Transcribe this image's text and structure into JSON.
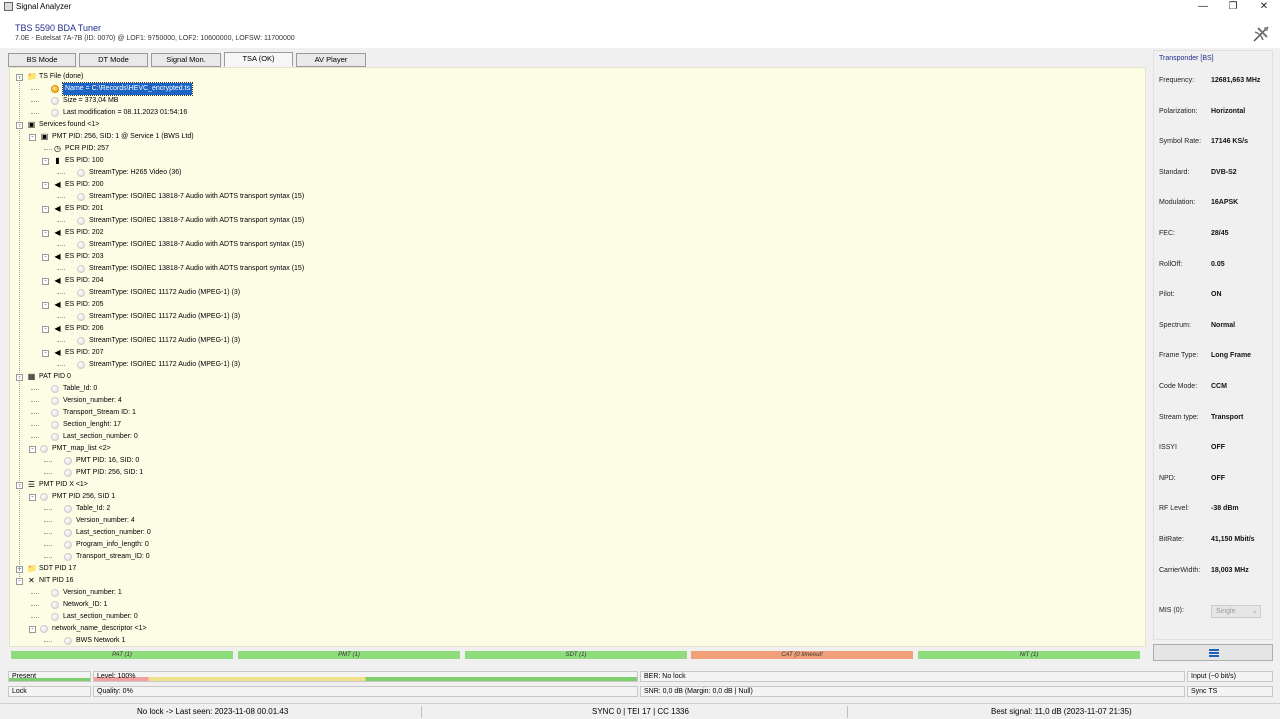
{
  "window": {
    "title": "Signal Analyzer",
    "controls": [
      "—",
      "❐",
      "✕"
    ]
  },
  "header": {
    "tuner_name": "TBS 5590 BDA Tuner",
    "tuner_info": "7.0E - Eutelsat 7A-7B (ID: 0070) @ LOF1: 9750000, LOF2: 10600000, LOFSW: 11700000"
  },
  "tabs": [
    {
      "label": "BS Mode"
    },
    {
      "label": "DT Mode"
    },
    {
      "label": "Signal Mon."
    },
    {
      "label": "TSA (OK)",
      "active": true
    },
    {
      "label": "AV Player"
    }
  ],
  "tree": [
    {
      "text": "TS File (done)",
      "depth": 0,
      "exp": "-",
      "icon": "folder-icon"
    },
    {
      "text": "Name = C:\\Records\\HEVC_encrypted.ts",
      "depth": 1,
      "icon": "dot-orange",
      "selected": true
    },
    {
      "text": "Size = 373,04 MB",
      "depth": 1,
      "icon": "dot"
    },
    {
      "text": "Last modification = 08.11.2023 01:54:16",
      "depth": 1,
      "icon": "dot"
    },
    {
      "text": "Services found <1>",
      "depth": 0,
      "exp": "-",
      "icon": "tv-icon"
    },
    {
      "text": "PMT PID: 256, SID: 1 @ Service 1 (BWS Ltd)",
      "depth": 1,
      "exp": "-",
      "icon": "tv-icon"
    },
    {
      "text": "PCR PID: 257",
      "depth": 2,
      "icon": "clock-icon"
    },
    {
      "text": "ES PID: 100",
      "depth": 2,
      "exp": "-",
      "icon": "film-icon"
    },
    {
      "text": "StreamType: H265 Video (36)",
      "depth": 3,
      "icon": "dot"
    },
    {
      "text": "ES PID: 200",
      "depth": 2,
      "exp": "-",
      "icon": "speaker-icon"
    },
    {
      "text": "StreamType: ISO/IEC 13818-7 Audio with ADTS transport syntax (15)",
      "depth": 3,
      "icon": "dot"
    },
    {
      "text": "ES PID: 201",
      "depth": 2,
      "exp": "-",
      "icon": "speaker-icon"
    },
    {
      "text": "StreamType: ISO/IEC 13818-7 Audio with ADTS transport syntax (15)",
      "depth": 3,
      "icon": "dot"
    },
    {
      "text": "ES PID: 202",
      "depth": 2,
      "exp": "-",
      "icon": "speaker-icon"
    },
    {
      "text": "StreamType: ISO/IEC 13818-7 Audio with ADTS transport syntax (15)",
      "depth": 3,
      "icon": "dot"
    },
    {
      "text": "ES PID: 203",
      "depth": 2,
      "exp": "-",
      "icon": "speaker-icon"
    },
    {
      "text": "StreamType: ISO/IEC 13818-7 Audio with ADTS transport syntax (15)",
      "depth": 3,
      "icon": "dot"
    },
    {
      "text": "ES PID: 204",
      "depth": 2,
      "exp": "-",
      "icon": "speaker-icon"
    },
    {
      "text": "StreamType: ISO/IEC 11172 Audio (MPEG-1) (3)",
      "depth": 3,
      "icon": "dot"
    },
    {
      "text": "ES PID: 205",
      "depth": 2,
      "exp": "-",
      "icon": "speaker-icon"
    },
    {
      "text": "StreamType: ISO/IEC 11172 Audio (MPEG-1) (3)",
      "depth": 3,
      "icon": "dot"
    },
    {
      "text": "ES PID: 206",
      "depth": 2,
      "exp": "-",
      "icon": "speaker-icon"
    },
    {
      "text": "StreamType: ISO/IEC 11172 Audio (MPEG-1) (3)",
      "depth": 3,
      "icon": "dot"
    },
    {
      "text": "ES PID: 207",
      "depth": 2,
      "exp": "-",
      "icon": "speaker-icon"
    },
    {
      "text": "StreamType: ISO/IEC 11172 Audio (MPEG-1) (3)",
      "depth": 3,
      "icon": "dot"
    },
    {
      "text": "PAT PID 0",
      "depth": 0,
      "exp": "-",
      "icon": "table-icon"
    },
    {
      "text": "Table_Id: 0",
      "depth": 1,
      "icon": "dot"
    },
    {
      "text": "Version_number: 4",
      "depth": 1,
      "icon": "dot"
    },
    {
      "text": "Transport_Stream ID: 1",
      "depth": 1,
      "icon": "dot"
    },
    {
      "text": "Section_lenght: 17",
      "depth": 1,
      "icon": "dot"
    },
    {
      "text": "Last_section_number: 0",
      "depth": 1,
      "icon": "dot"
    },
    {
      "text": "PMT_map_list <2>",
      "depth": 1,
      "exp": "-",
      "icon": "dot"
    },
    {
      "text": "PMT PID: 16, SID: 0",
      "depth": 2,
      "icon": "dot"
    },
    {
      "text": "PMT PID: 256, SID: 1",
      "depth": 2,
      "icon": "dot"
    },
    {
      "text": "PMT PID X <1>",
      "depth": 0,
      "exp": "-",
      "icon": "list-icon"
    },
    {
      "text": "PMT PID 256, SID 1",
      "depth": 1,
      "exp": "-",
      "icon": "dot"
    },
    {
      "text": "Table_Id: 2",
      "depth": 2,
      "icon": "dot"
    },
    {
      "text": "Version_number: 4",
      "depth": 2,
      "icon": "dot"
    },
    {
      "text": "Last_section_number: 0",
      "depth": 2,
      "icon": "dot"
    },
    {
      "text": "Program_info_length: 0",
      "depth": 2,
      "icon": "dot"
    },
    {
      "text": "Transport_stream_ID: 0",
      "depth": 2,
      "icon": "dot"
    },
    {
      "text": "SDT PID 17",
      "depth": 0,
      "exp": "+",
      "icon": "folder-icon"
    },
    {
      "text": "NIT PID 16",
      "depth": 0,
      "exp": "-",
      "icon": "satellite-icon"
    },
    {
      "text": "Version_number: 1",
      "depth": 1,
      "icon": "dot"
    },
    {
      "text": "Network_ID: 1",
      "depth": 1,
      "icon": "dot"
    },
    {
      "text": "Last_section_number: 0",
      "depth": 1,
      "icon": "dot"
    },
    {
      "text": "network_name_descriptor <1>",
      "depth": 1,
      "exp": "-",
      "icon": "dot"
    },
    {
      "text": "BWS Network 1",
      "depth": 2,
      "icon": "dot"
    }
  ],
  "transponder": {
    "header": "Transponder [BS]",
    "rows": [
      {
        "label": "Frequency:",
        "value": "12681,663 MHz"
      },
      {
        "label": "Polarization:",
        "value": "Horizontal"
      },
      {
        "label": "Symbol Rate:",
        "value": "17146 KS/s"
      },
      {
        "label": "Standard:",
        "value": "DVB-S2"
      },
      {
        "label": "Modulation:",
        "value": "16APSK"
      },
      {
        "label": "FEC:",
        "value": "28/45"
      },
      {
        "label": "RollOff:",
        "value": "0.05"
      },
      {
        "label": "Pilot:",
        "value": "ON"
      },
      {
        "label": "Spectrum:",
        "value": "Normal"
      },
      {
        "label": "Frame Type:",
        "value": "Long Frame"
      },
      {
        "label": "Code Mode:",
        "value": "CCM"
      },
      {
        "label": "Stream type:",
        "value": "Transport"
      },
      {
        "label": "ISSYI",
        "value": "OFF"
      },
      {
        "label": "NPD:",
        "value": "OFF"
      },
      {
        "label": "RF Level:",
        "value": "-38 dBm"
      },
      {
        "label": "BitRate:",
        "value": "41,150 Mbit/s"
      },
      {
        "label": "CarrierWidth:",
        "value": "18,003 MHz"
      }
    ],
    "mis_label": "MIS (0):",
    "mis_value": "Single"
  },
  "pid_bars": [
    {
      "label": "PAT (1)",
      "color": "#8fdc7c"
    },
    {
      "label": "PMT (1)",
      "color": "#8fdc7c"
    },
    {
      "label": "SDT (1)",
      "color": "#8fdc7c"
    },
    {
      "label": "CAT (0 timeout!",
      "color": "#f2a07a"
    },
    {
      "label": "NIT (1)",
      "color": "#8fdc7c"
    }
  ],
  "status": {
    "present": "Present",
    "lock": "Lock",
    "level": "Level: 100%",
    "level_fraction": 1.0,
    "quality": "Quality: 0%",
    "ber": "BER: No lock",
    "snr": "SNR: 0,0 dB (Margin: 0,0 dB | Null)",
    "input": "Input (~0 bit/s)",
    "sync": "Sync TS"
  },
  "bottom": {
    "last_seen": "No lock -> Last seen: 2023-11-08 00.01.43",
    "sync_info": "SYNC 0 | TEI 17 | CC 1336",
    "best_signal": "Best signal: 11,0 dB (2023-11-07 21:35)"
  }
}
